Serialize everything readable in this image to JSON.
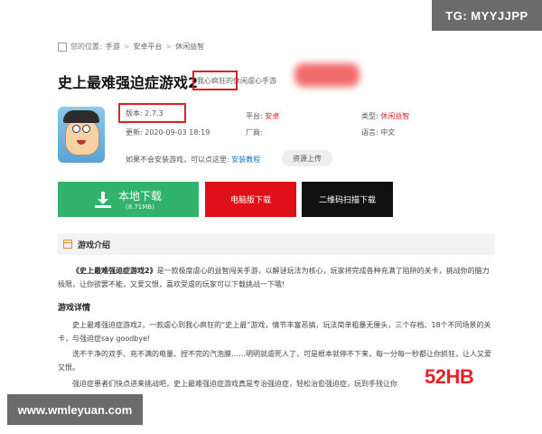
{
  "watermarks": {
    "top": "TG: MYYJJPP",
    "bottom": "www.wmleyuan.com",
    "logo": "52HB"
  },
  "breadcrumb": [
    "您的位置:",
    "手游",
    "安卓平台",
    "休闲益智"
  ],
  "game": {
    "title": "史上最难强迫症游戏2",
    "subtitle": "我心疯狂的休闲虐心手游",
    "version_label": "版本:",
    "version": "2.7.3",
    "update_label": "更新:",
    "update": "2020-09-03 18:19",
    "platform_label": "平台:",
    "platform": "安卓",
    "vendor_label": "厂商:",
    "vendor": "",
    "type_label": "类型:",
    "type": "休闲益智",
    "lang_label": "语言:",
    "lang": "中文",
    "install_hint": "如果不会安装游戏，可以点这里:",
    "install_link": "安装教程",
    "upload_button": "资源上传"
  },
  "downloads": {
    "local_label": "本地下载",
    "local_size": "(8.71MB)",
    "pc_label": "电脑版下载",
    "qr_label": "二维码扫描下载"
  },
  "intro": {
    "section_title": "游戏介绍",
    "para1_title": "《史上最难强迫症游戏2》",
    "para1": "是一款极度虐心的益智闯关手游，以解谜玩法为核心，玩家将完成各种充满了陷阱的关卡，挑战你的脑力极限，让你欲罢不能，又爱又恨，喜欢受虐的玩家可以下载挑战一下哦!",
    "detail_title": "游戏详情",
    "para2": "史上最难强迫症游戏2，一款虐心到我心疯狂的“史上最”游戏，情节丰富恶搞，玩法简单粗暴无厘头，三个存档、18个不同场景的关卡，与强迫症say goodbye!",
    "para3": "洗不干净的双手、充不满的电量、捏不完的汽泡膜……明明就虐死人了，可是根本就停不下来，每一分每一秒都让你抓狂，让人又爱又恨。",
    "para4": "强迫症患者们快点进来挑战吧，史上最难强迫症游戏真是专治强迫症，轻松治愈强迫症，玩到手残让你"
  },
  "colors": {
    "green": "#31b36b",
    "red": "#e0101a",
    "black": "#111111",
    "highlight_box": "#d22222"
  }
}
